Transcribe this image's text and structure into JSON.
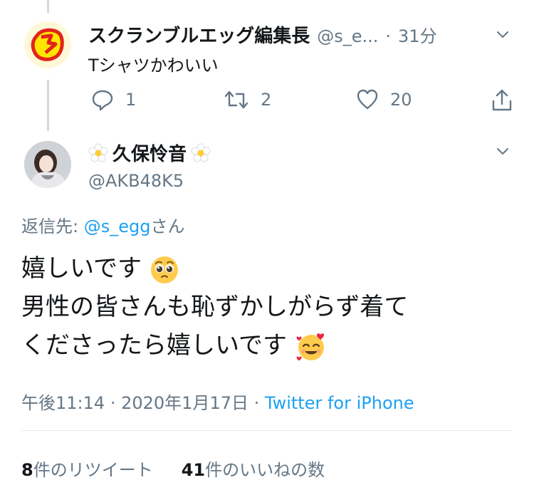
{
  "tweet1": {
    "display_name": "スクランブルエッグ編集長",
    "handle": "@s_e...",
    "dot": "·",
    "time": "31分",
    "text": "Tシャツかわいい",
    "replies": "1",
    "retweets": "2",
    "likes": "20"
  },
  "tweet2": {
    "display_name": "久保怜音",
    "handle": "@AKB48K5",
    "reply_prefix": "返信先:",
    "reply_handle": "@s_egg",
    "reply_suffix": "さん",
    "line1": "嬉しいです",
    "line2": "男性の皆さんも恥ずかしがらず着て",
    "line3": "くださったら嬉しいです",
    "time": "午後11:14",
    "sep1": "·",
    "date": "2020年1月17日",
    "sep2": "·",
    "source": "Twitter for iPhone",
    "retweet_count": "8",
    "retweet_label": "件のリツイート",
    "like_count": "41",
    "like_label": "件のいいねの数"
  },
  "colors": {
    "accent": "#1da1f2",
    "muted": "#657786",
    "divider": "#e6ecf0"
  },
  "icons": [
    "chevron-down-icon",
    "reply-icon",
    "retweet-icon",
    "like-icon",
    "share-icon",
    "flower-emoji",
    "pleading-face-emoji",
    "smiling-face-with-hearts-emoji"
  ]
}
